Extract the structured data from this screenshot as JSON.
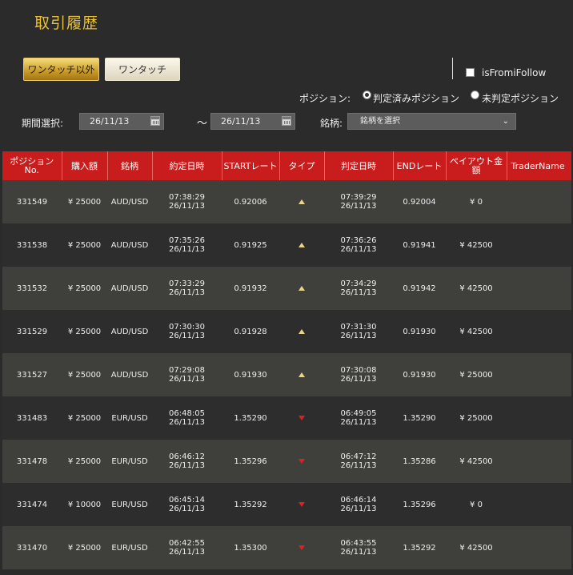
{
  "page": {
    "title": "取引履歴"
  },
  "tabs": {
    "active_label": "ワンタッチ以外",
    "inactive_label": "ワンタッチ"
  },
  "follow": {
    "label": "isFromiFollow"
  },
  "position_filter": {
    "label": "ポジション:",
    "options": [
      "判定済みポジション",
      "未判定ポジション"
    ],
    "selected": "判定済みポジション"
  },
  "period": {
    "label": "期間選択:",
    "from": "26/11/13",
    "separator": "〜",
    "to": "26/11/13"
  },
  "symbol": {
    "label": "銘柄:",
    "selected": "銘柄を選択"
  },
  "table": {
    "headers": [
      "ポジション No.",
      "購入額",
      "銘柄",
      "約定日時",
      "STARTレート",
      "タイプ",
      "判定日時",
      "ENDレート",
      "ペイアウト金額",
      "TraderName"
    ],
    "rows": [
      {
        "id": "331549",
        "amount": "¥ 25000",
        "symbol": "AUD/USD",
        "exec_time": "07:38:29",
        "exec_date": "26/11/13",
        "start_rate": "0.92006",
        "type": "up",
        "judge_time": "07:39:29",
        "judge_date": "26/11/13",
        "end_rate": "0.92004",
        "payout": "¥ 0",
        "trader": ""
      },
      {
        "id": "331538",
        "amount": "¥ 25000",
        "symbol": "AUD/USD",
        "exec_time": "07:35:26",
        "exec_date": "26/11/13",
        "start_rate": "0.91925",
        "type": "up",
        "judge_time": "07:36:26",
        "judge_date": "26/11/13",
        "end_rate": "0.91941",
        "payout": "¥ 42500",
        "trader": ""
      },
      {
        "id": "331532",
        "amount": "¥ 25000",
        "symbol": "AUD/USD",
        "exec_time": "07:33:29",
        "exec_date": "26/11/13",
        "start_rate": "0.91932",
        "type": "up",
        "judge_time": "07:34:29",
        "judge_date": "26/11/13",
        "end_rate": "0.91942",
        "payout": "¥ 42500",
        "trader": ""
      },
      {
        "id": "331529",
        "amount": "¥ 25000",
        "symbol": "AUD/USD",
        "exec_time": "07:30:30",
        "exec_date": "26/11/13",
        "start_rate": "0.91928",
        "type": "up",
        "judge_time": "07:31:30",
        "judge_date": "26/11/13",
        "end_rate": "0.91930",
        "payout": "¥ 42500",
        "trader": ""
      },
      {
        "id": "331527",
        "amount": "¥ 25000",
        "symbol": "AUD/USD",
        "exec_time": "07:29:08",
        "exec_date": "26/11/13",
        "start_rate": "0.91930",
        "type": "up",
        "judge_time": "07:30:08",
        "judge_date": "26/11/13",
        "end_rate": "0.91930",
        "payout": "¥ 25000",
        "trader": ""
      },
      {
        "id": "331483",
        "amount": "¥ 25000",
        "symbol": "EUR/USD",
        "exec_time": "06:48:05",
        "exec_date": "26/11/13",
        "start_rate": "1.35290",
        "type": "down",
        "judge_time": "06:49:05",
        "judge_date": "26/11/13",
        "end_rate": "1.35290",
        "payout": "¥ 25000",
        "trader": ""
      },
      {
        "id": "331478",
        "amount": "¥ 25000",
        "symbol": "EUR/USD",
        "exec_time": "06:46:12",
        "exec_date": "26/11/13",
        "start_rate": "1.35296",
        "type": "down",
        "judge_time": "06:47:12",
        "judge_date": "26/11/13",
        "end_rate": "1.35286",
        "payout": "¥ 42500",
        "trader": ""
      },
      {
        "id": "331474",
        "amount": "¥ 10000",
        "symbol": "EUR/USD",
        "exec_time": "06:45:14",
        "exec_date": "26/11/13",
        "start_rate": "1.35292",
        "type": "down",
        "judge_time": "06:46:14",
        "judge_date": "26/11/13",
        "end_rate": "1.35296",
        "payout": "¥ 0",
        "trader": ""
      },
      {
        "id": "331470",
        "amount": "¥ 25000",
        "symbol": "EUR/USD",
        "exec_time": "06:42:55",
        "exec_date": "26/11/13",
        "start_rate": "1.35300",
        "type": "down",
        "judge_time": "06:43:55",
        "judge_date": "26/11/13",
        "end_rate": "1.35292",
        "payout": "¥ 42500",
        "trader": ""
      }
    ]
  },
  "colors": {
    "accent_gold": "#e9c23a",
    "header_red": "#c91d1d",
    "up_arrow": "#e8d58a",
    "down_arrow": "#e02020"
  }
}
